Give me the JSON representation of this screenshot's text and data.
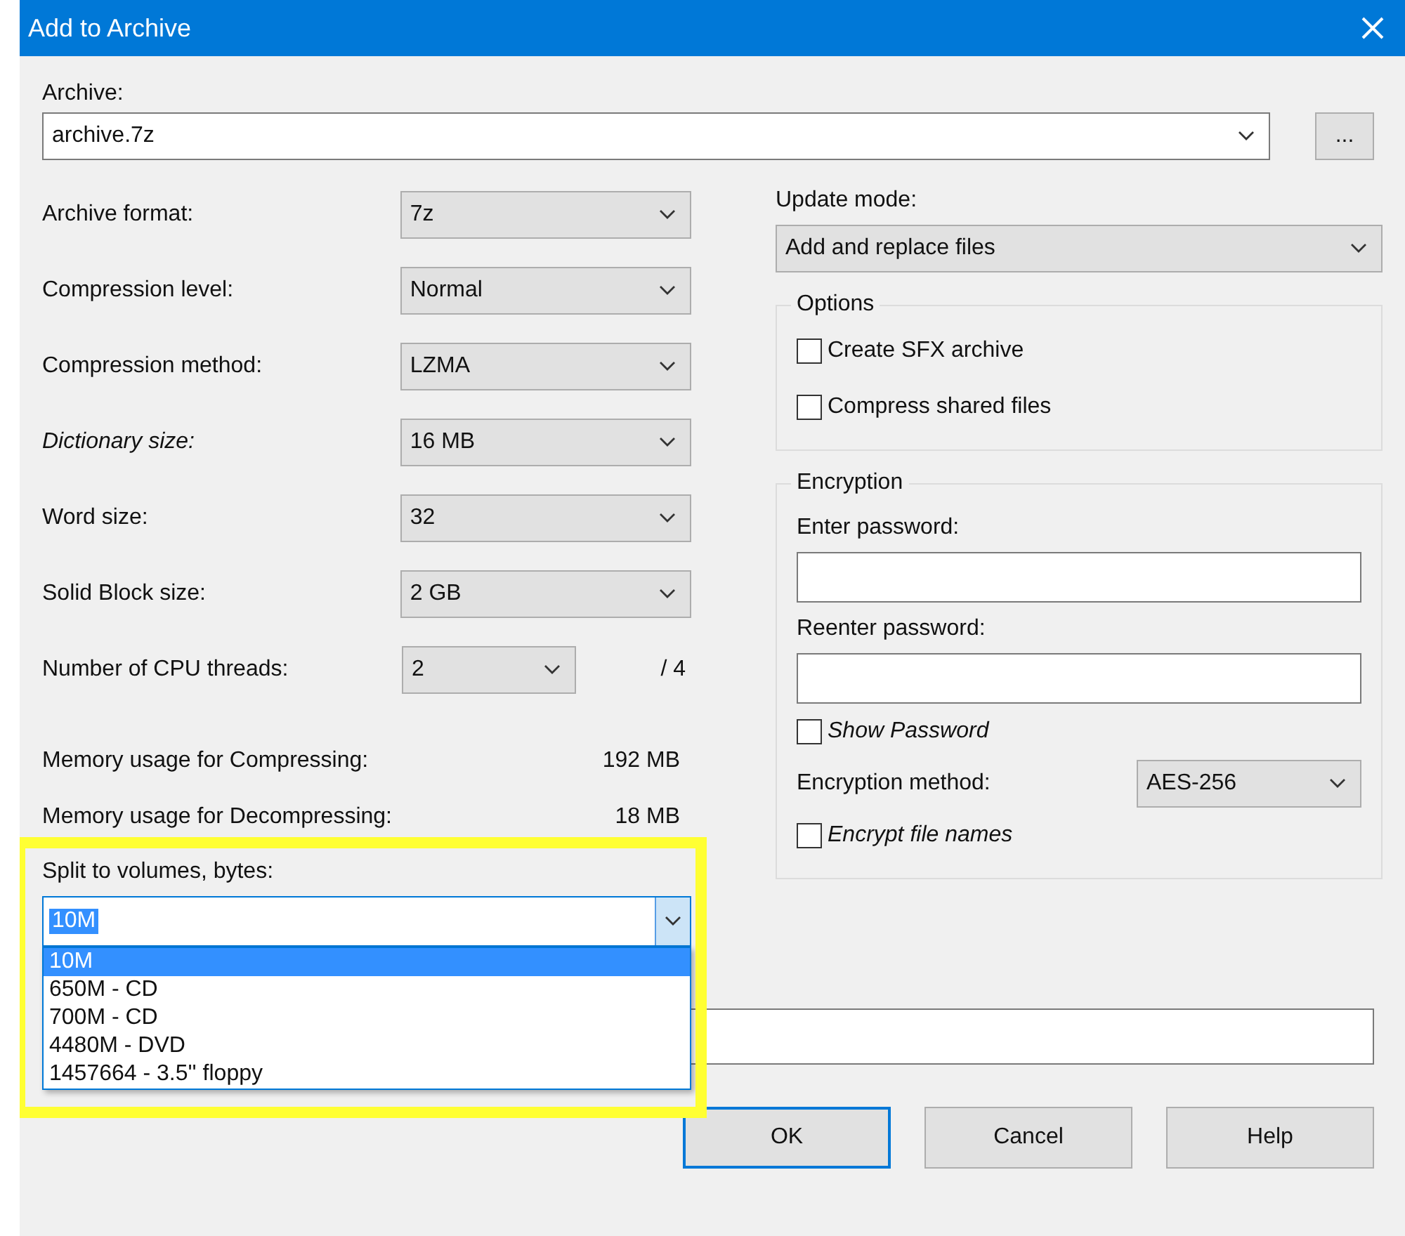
{
  "window": {
    "title": "Add to Archive"
  },
  "archive": {
    "label": "Archive:",
    "value": "archive.7z",
    "browse": "..."
  },
  "settings": [
    {
      "label": "Archive format:",
      "value": "7z",
      "italic": false
    },
    {
      "label": "Compression level:",
      "value": "Normal",
      "italic": false
    },
    {
      "label": "Compression method:",
      "value": "LZMA",
      "italic": false
    },
    {
      "label": "Dictionary size:",
      "value": "16 MB",
      "italic": true
    },
    {
      "label": "Word size:",
      "value": "32",
      "italic": false
    },
    {
      "label": "Solid Block size:",
      "value": "2 GB",
      "italic": false
    }
  ],
  "threads": {
    "label": "Number of CPU threads:",
    "value": "2",
    "max": "/ 4"
  },
  "memory": [
    {
      "label": "Memory usage for Compressing:",
      "value": "192 MB"
    },
    {
      "label": "Memory usage for Decompressing:",
      "value": "18 MB"
    }
  ],
  "split": {
    "label": "Split to volumes, bytes:",
    "value": "10M",
    "options": [
      {
        "label": "10M",
        "selected": true
      },
      {
        "label": "650M - CD",
        "selected": false
      },
      {
        "label": "700M - CD",
        "selected": false
      },
      {
        "label": "4480M - DVD",
        "selected": false
      },
      {
        "label": "1457664 - 3.5'' floppy",
        "selected": false
      }
    ]
  },
  "update_mode": {
    "label": "Update mode:",
    "value": "Add and replace files"
  },
  "options": {
    "title": "Options",
    "checkboxes": [
      {
        "label": "Create SFX archive",
        "checked": false
      },
      {
        "label": "Compress shared files",
        "checked": false
      }
    ]
  },
  "encryption": {
    "title": "Encryption",
    "enter_label": "Enter password:",
    "reenter_label": "Reenter password:",
    "show_password": {
      "label": "Show Password",
      "checked": false
    },
    "method": {
      "label": "Encryption method:",
      "value": "AES-256"
    },
    "encrypt_names": {
      "label": "Encrypt file names",
      "checked": false
    }
  },
  "buttons": [
    {
      "label": "OK",
      "default": true
    },
    {
      "label": "Cancel",
      "default": false
    },
    {
      "label": "Help",
      "default": false
    }
  ]
}
